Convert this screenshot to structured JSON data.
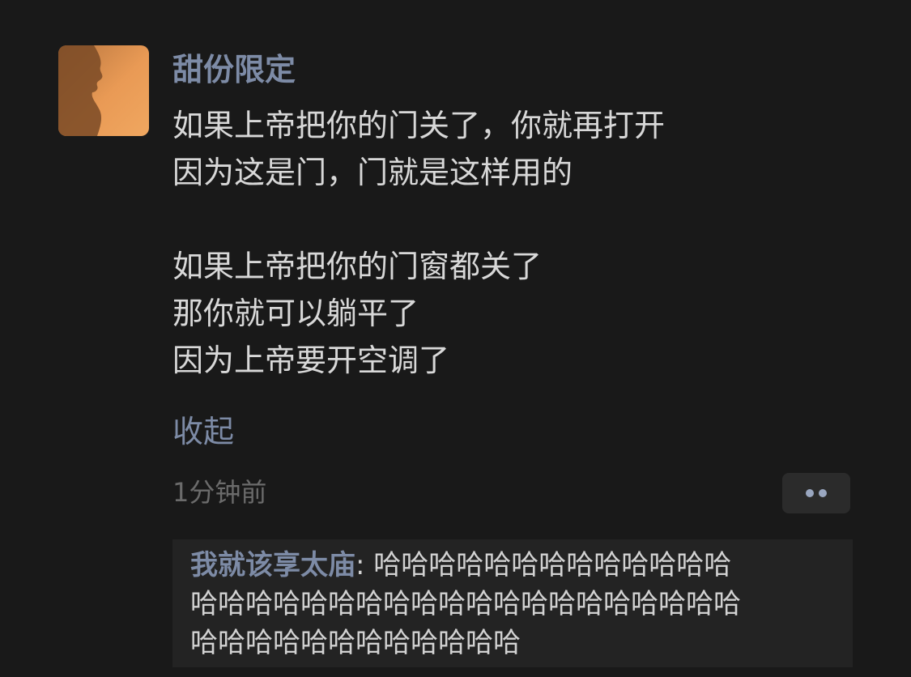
{
  "post": {
    "author": "甜份限定",
    "avatar_icon": "silhouette-avatar",
    "lines": [
      "如果上帝把你的门关了，你就再打开",
      "因为这是门，门就是这样用的",
      "",
      "如果上帝把你的门窗都关了",
      "那你就可以躺平了",
      "因为上帝要开空调了"
    ],
    "collapse_label": "收起",
    "time": "1分钟前",
    "more_icon": "more-dots-icon"
  },
  "comment": {
    "author": "我就该享太庙",
    "separator": ": ",
    "text_lines": [
      "哈哈哈哈哈哈哈哈哈哈哈哈哈",
      "哈哈哈哈哈哈哈哈哈哈哈哈哈哈哈哈哈哈哈哈",
      "哈哈哈哈哈哈哈哈哈哈哈哈"
    ]
  },
  "colors": {
    "background": "#191919",
    "name_accent": "#7d8ba6",
    "body_text": "#d8d8d8",
    "meta_text": "#6b6b6b",
    "comment_bg": "#232323",
    "avatar_orange": "#e89a57"
  }
}
